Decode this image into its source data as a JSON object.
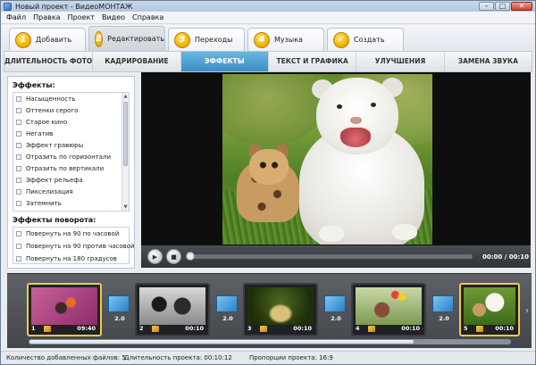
{
  "window": {
    "title": "Новый проект - ВидеоМОНТАЖ",
    "minimize": "–",
    "maximize": "□",
    "close": "✕"
  },
  "menu": [
    "Файл",
    "Правка",
    "Проект",
    "Видео",
    "Справка"
  ],
  "steps": [
    {
      "num": "1",
      "label": "Добавить"
    },
    {
      "num": "2",
      "label": "Редактировать",
      "active": true
    },
    {
      "num": "3",
      "label": "Переходы"
    },
    {
      "num": "4",
      "label": "Музыка"
    },
    {
      "num": "✓",
      "label": "Создать"
    }
  ],
  "subtabs": [
    "ДЛИТЕЛЬНОСТЬ ФОТО",
    "КАДРИРОВАНИЕ",
    "ЭФФЕКТЫ",
    "ТЕКСТ И ГРАФИКА",
    "УЛУЧШЕНИЯ",
    "ЗАМЕНА ЗВУКА"
  ],
  "active_subtab": "ЭФФЕКТЫ",
  "effects_panel": {
    "heading": "Эффекты:",
    "items": [
      "Насыщенность",
      "Оттенки серого",
      "Старое кино",
      "Негатив",
      "Эффект гравюры",
      "Отразить по горизонтали",
      "Отразить по вертикали",
      "Эффект рельефа",
      "Пикселизация",
      "Затемнить"
    ],
    "rotation_heading": "Эффекты поворота:",
    "rotation_items": [
      "Повернуть на 90 по часовой",
      "Повернуть на 90 против часовой",
      "Повернуть на 180 градусов"
    ]
  },
  "player": {
    "play_icon": "play-icon",
    "stop_icon": "stop-icon",
    "timecode": "00:00 / 00:10",
    "progress": 0
  },
  "timeline": {
    "clips": [
      {
        "num": "1",
        "duration": "09:40",
        "selected": true
      },
      {
        "num": "2",
        "duration": "00:10"
      },
      {
        "num": "3",
        "duration": "00:10"
      },
      {
        "num": "4",
        "duration": "00:10"
      },
      {
        "num": "5",
        "duration": "00:10",
        "selected": true
      }
    ],
    "transitions": [
      "2.0",
      "2.0",
      "2.0",
      "2.0"
    ],
    "next_arrow": "›",
    "scroll_fraction": 0.8
  },
  "status": {
    "files_added": "Количество добавленных файлов: 5",
    "duration": "Длительность проекта:  00:10:12",
    "aspect": "Пропорции проекта:  16:9"
  },
  "colors": {
    "accent": "#3a8fc6",
    "step_badge": "#f3b400",
    "selected_clip": "#f2c94c"
  }
}
